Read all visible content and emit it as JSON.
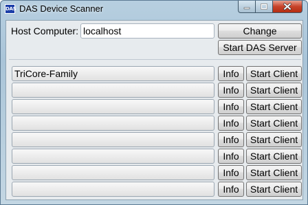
{
  "window": {
    "title": "DAS Device Scanner",
    "icon_text": "DAS",
    "controls": {
      "minimize": "minimize-icon",
      "maximize": "maximize-icon",
      "close": "close-icon"
    }
  },
  "host": {
    "label": "Host Computer:",
    "value": "localhost",
    "change_button": "Change",
    "start_server_button": "Start DAS Server"
  },
  "clients": [
    {
      "name": "TriCore-Family",
      "info": "Info",
      "start": "Start Client"
    },
    {
      "name": "",
      "info": "Info",
      "start": "Start Client"
    },
    {
      "name": "",
      "info": "Info",
      "start": "Start Client"
    },
    {
      "name": "",
      "info": "Info",
      "start": "Start Client"
    },
    {
      "name": "",
      "info": "Info",
      "start": "Start Client"
    },
    {
      "name": "",
      "info": "Info",
      "start": "Start Client"
    },
    {
      "name": "",
      "info": "Info",
      "start": "Start Client"
    },
    {
      "name": "",
      "info": "Info",
      "start": "Start Client"
    }
  ],
  "colors": {
    "close_button": "#c7432a",
    "titlebar": "#a9c4d8"
  }
}
